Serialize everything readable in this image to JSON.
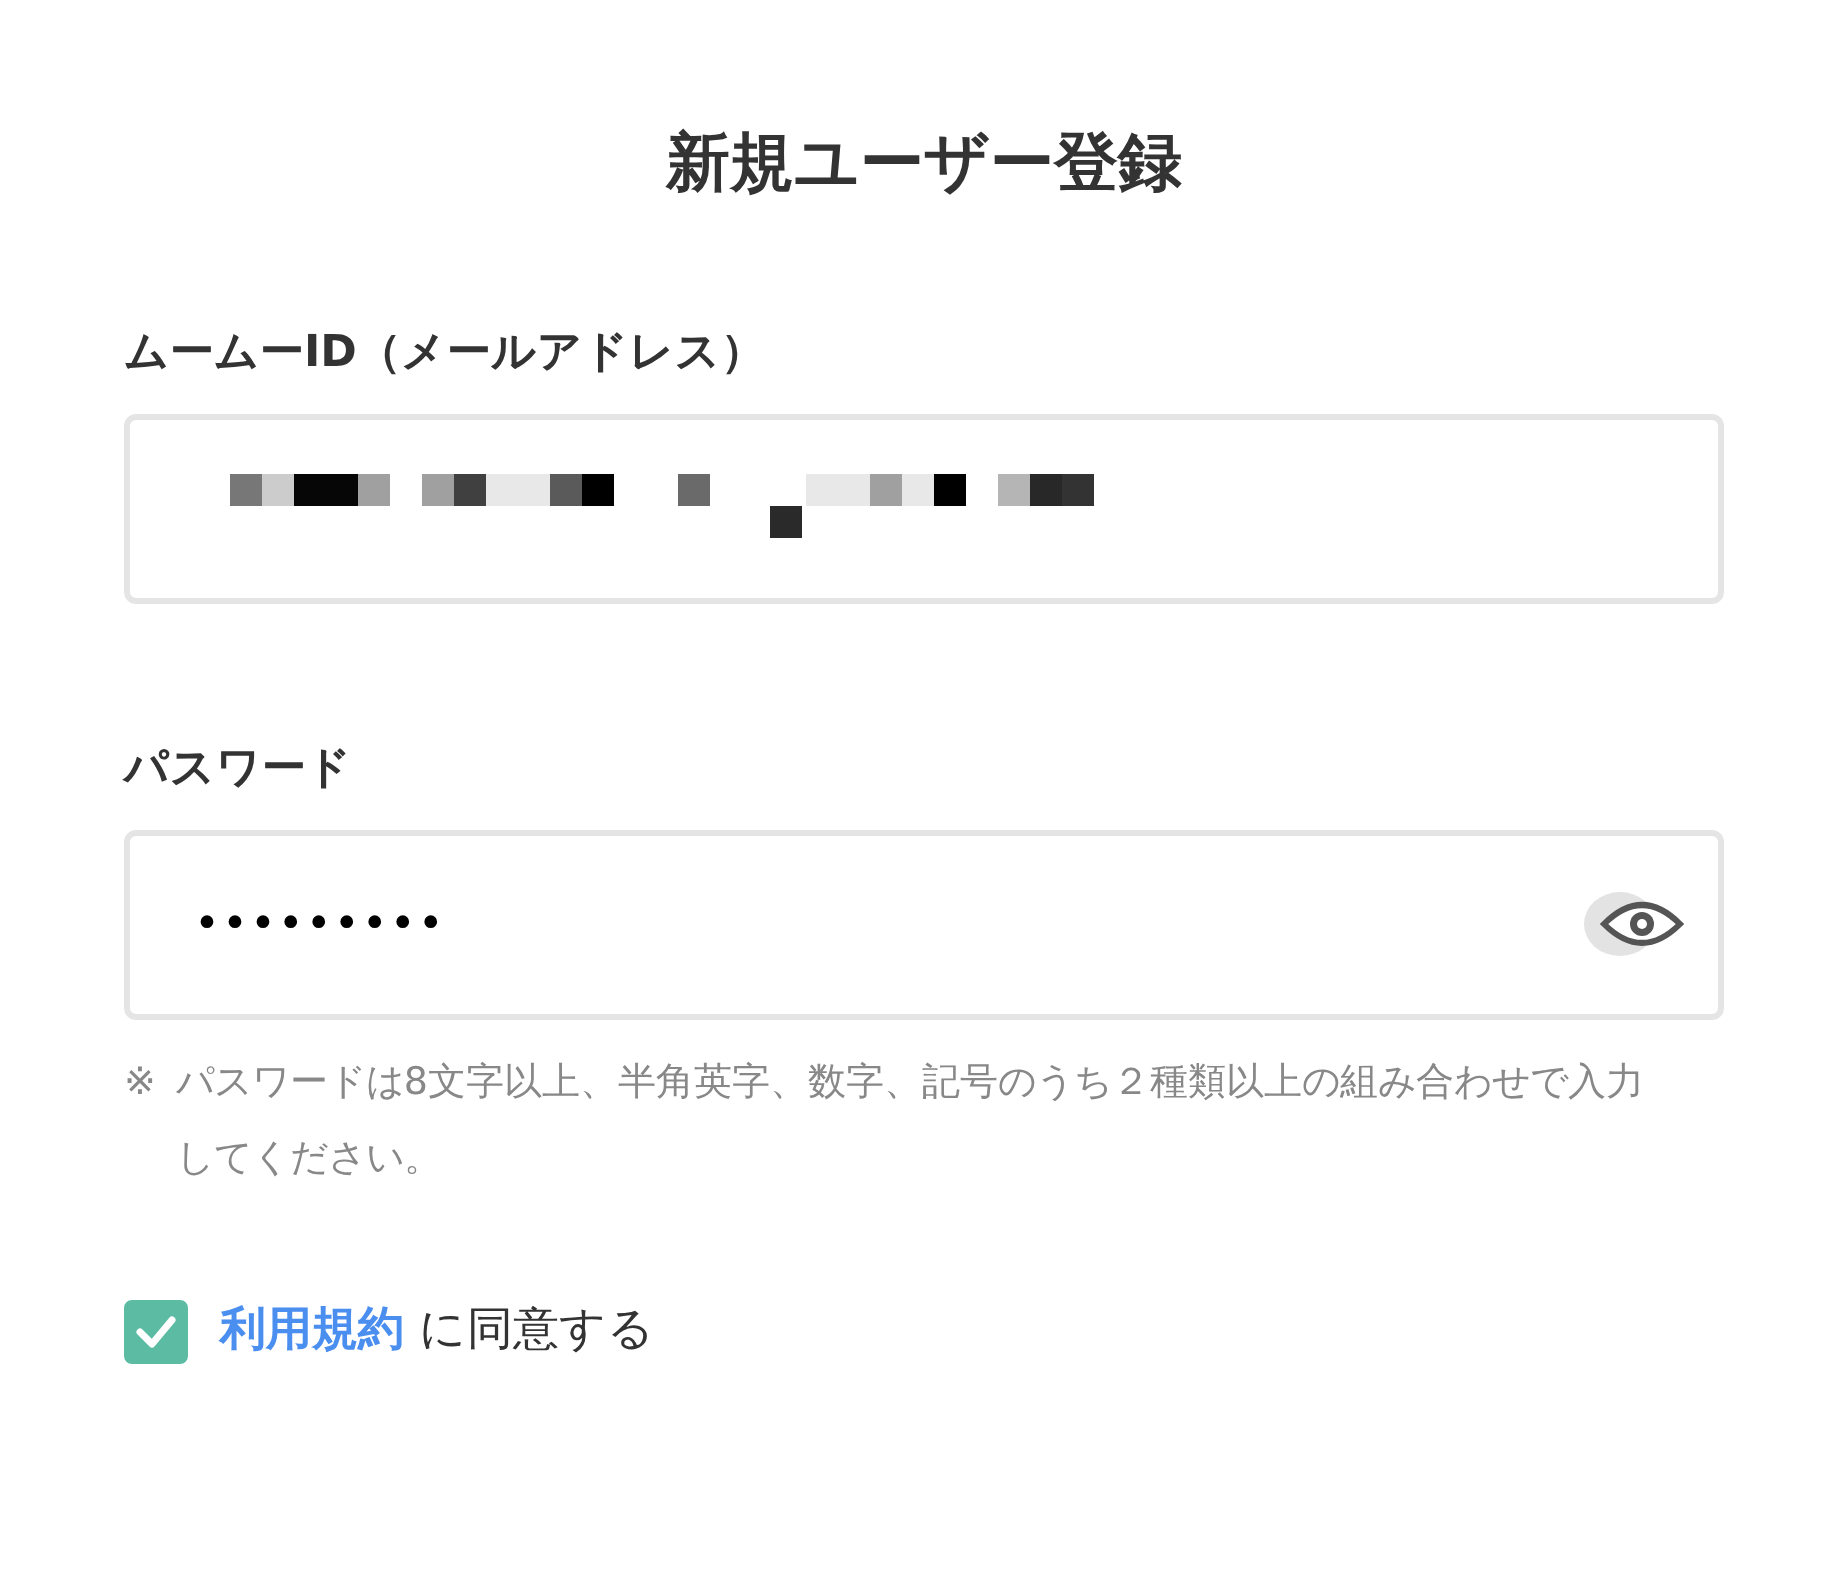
{
  "title": "新規ユーザー登録",
  "fields": [
    {
      "kind": "email",
      "label": "ムームーID（メールアドレス）",
      "redacted": true
    },
    {
      "kind": "password",
      "label": "パスワード",
      "value": "•••••••••",
      "note_mark": "※",
      "note": "パスワードは8文字以上、半角英字、数字、記号のうち２種類以上の組み合わせで入力してください。"
    }
  ],
  "agreement": {
    "checked": true,
    "link": "利用規約",
    "text": "に同意する"
  }
}
